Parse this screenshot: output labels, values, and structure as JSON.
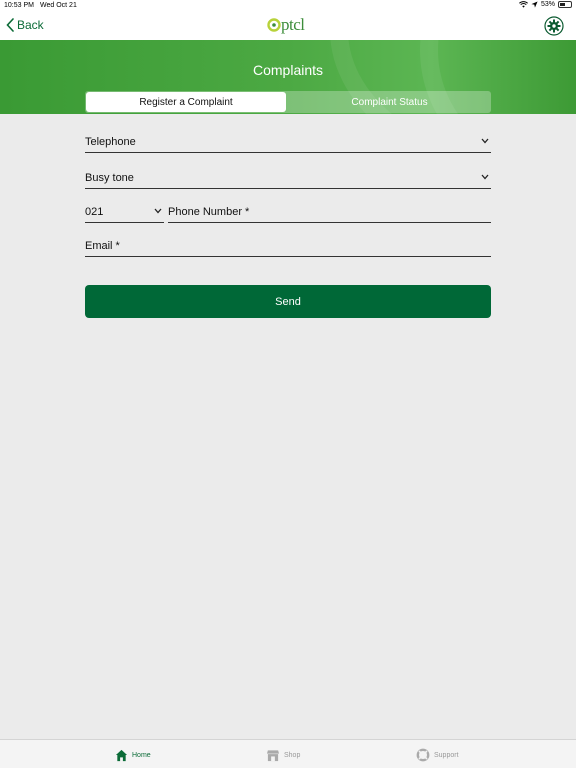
{
  "status_bar": {
    "time": "10:53 PM",
    "date": "Wed Oct 21",
    "battery": "53%",
    "battery_level": 0.53
  },
  "nav": {
    "back_label": "Back",
    "logo_text": "ptcl"
  },
  "header": {
    "title": "Complaints"
  },
  "tabs": [
    {
      "label": "Register a Complaint",
      "active": true
    },
    {
      "label": "Complaint Status",
      "active": false
    }
  ],
  "form": {
    "service": {
      "value": "Telephone"
    },
    "complaint_type": {
      "value": "Busy tone"
    },
    "area_code": {
      "value": "021"
    },
    "phone": {
      "label": "Phone Number *"
    },
    "email": {
      "label": "Email *"
    },
    "send_label": "Send"
  },
  "tab_bar": {
    "home": "Home",
    "shop": "Shop",
    "support": "Support"
  },
  "colors": {
    "brand_green": "#006837",
    "header_green": "#4ca943",
    "accent_text": "#0b6b37"
  }
}
